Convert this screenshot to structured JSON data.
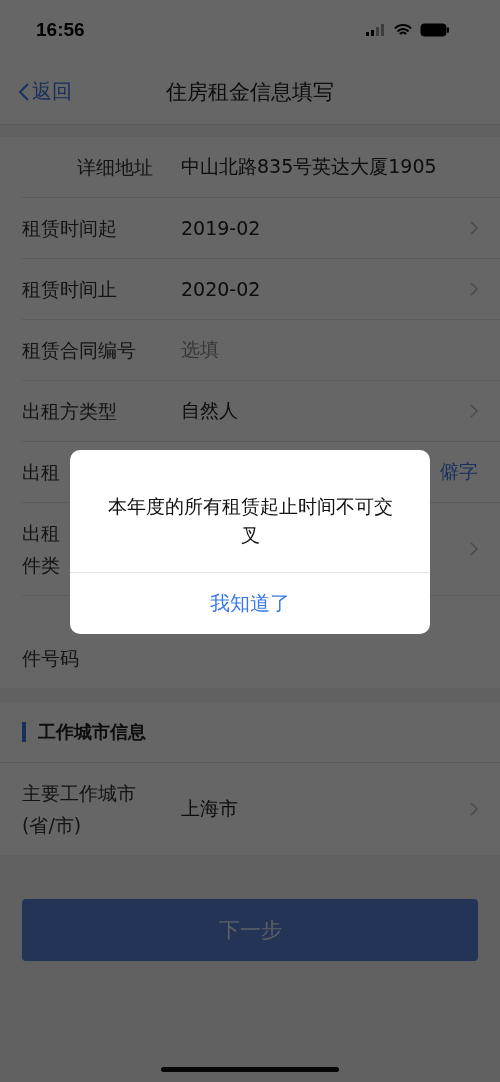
{
  "status_bar": {
    "time": "16:56"
  },
  "nav": {
    "back": "返回",
    "title": "住房租金信息填写"
  },
  "fields": [
    {
      "kind": "text",
      "label_lines": [
        "详细地址"
      ],
      "value": "中山北路835号英达大厦1905"
    },
    {
      "kind": "select",
      "label_lines": [
        "租赁时间起"
      ],
      "value": "2019-02"
    },
    {
      "kind": "select",
      "label_lines": [
        "租赁时间止"
      ],
      "value": "2020-02"
    },
    {
      "kind": "input",
      "label_lines": [
        "租赁合同编号"
      ],
      "placeholder": "选填"
    },
    {
      "kind": "select",
      "label_lines": [
        "出租方类型"
      ],
      "value": "自然人"
    },
    {
      "kind": "link",
      "label_lines": [
        "出租"
      ],
      "link": "僻字"
    },
    {
      "kind": "select",
      "label_lines": [
        "出租",
        "件类"
      ]
    },
    {
      "kind": "covered",
      "label_lines": [
        "件号码"
      ]
    }
  ],
  "section": {
    "title": "工作城市信息",
    "fields": [
      {
        "kind": "select",
        "label_lines": [
          "主要工作城市",
          "(省/市)"
        ],
        "value": "上海市"
      }
    ]
  },
  "next_button": {
    "label": "下一步",
    "disabled": true
  },
  "dialog": {
    "message": "本年度的所有租赁起止时间不可交叉",
    "button": "我知道了"
  }
}
